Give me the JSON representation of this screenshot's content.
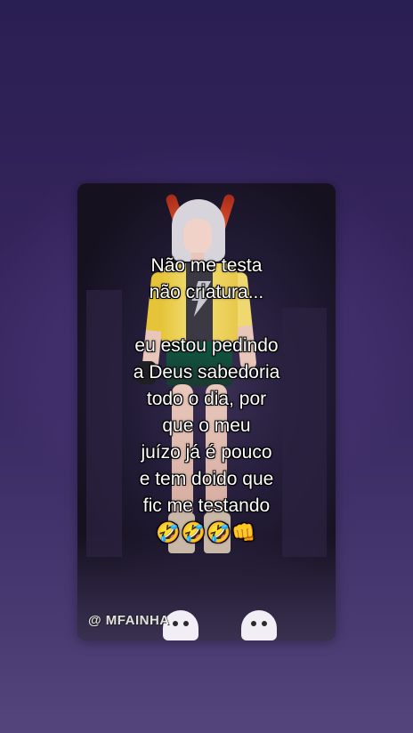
{
  "caption": {
    "lines": [
      "Não me testa",
      "não criatura...",
      "",
      "eu estou pedindo",
      "a Deus sabedoria",
      "todo o dia, por",
      "que o meu",
      "juízo já é pouco",
      "e tem doido que",
      "fic me testando"
    ],
    "emoji": "🤣🤣🤣👊"
  },
  "watermark": {
    "handle": "@ MFAINHA"
  },
  "colors": {
    "background_top": "#2a1f52",
    "background_bottom": "#55457d",
    "caption_text": "#ffffff",
    "jacket": "#e6c43a",
    "horns": "#a52a18"
  }
}
